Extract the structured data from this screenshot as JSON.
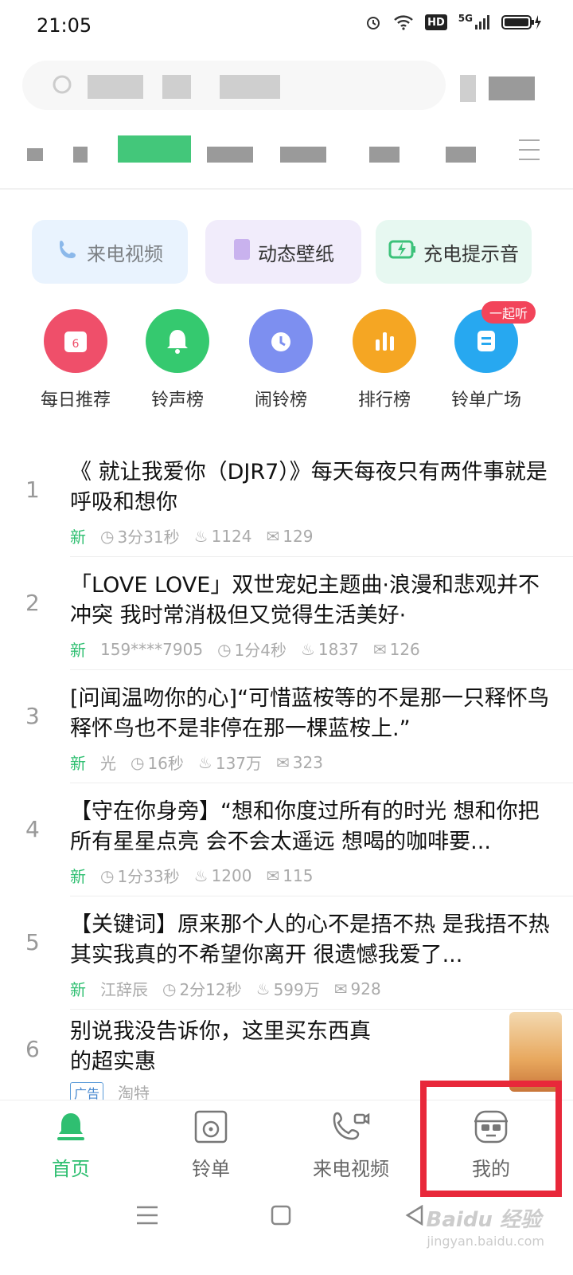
{
  "status_bar": {
    "time": "21:05",
    "hd": "HD",
    "net": "5G"
  },
  "quick_cards": [
    {
      "label": "来电视频"
    },
    {
      "label": "动态壁纸"
    },
    {
      "label": "充电提示音"
    }
  ],
  "categories": [
    {
      "label": "每日推荐",
      "color": "#ef4f6a"
    },
    {
      "label": "铃声榜",
      "color": "#35c96f"
    },
    {
      "label": "闹铃榜",
      "color": "#7d8ff0"
    },
    {
      "label": "排行榜",
      "color": "#f5a623"
    },
    {
      "label": "铃单广场",
      "color": "#27a8f0",
      "badge": "一起听"
    }
  ],
  "list": [
    {
      "num": "1",
      "title": "《 就让我爱你（DJR7）》每天每夜只有两件事就是呼吸和想你",
      "tag": "新",
      "author": "",
      "duration": "3分31秒",
      "likes": "1124",
      "comments": "129"
    },
    {
      "num": "2",
      "title": "「LOVE LOVE」双世宠妃主题曲·浪漫和悲观并不冲突 我时常消极但又觉得生活美好·",
      "tag": "新",
      "author": "159****7905",
      "duration": "1分4秒",
      "likes": "1837",
      "comments": "126"
    },
    {
      "num": "3",
      "title": "[问闻温吻你的心]“可惜蓝桉等的不是那一只释怀鸟 释怀鸟也不是非停在那一棵蓝桉上.”",
      "tag": "新",
      "author": "光",
      "duration": "16秒",
      "likes": "137万",
      "comments": "323"
    },
    {
      "num": "4",
      "title": "【守在你身旁】“想和你度过所有的时光 想和你把所有星星点亮 会不会太遥远 想喝的咖啡要...",
      "tag": "新",
      "author": "",
      "duration": "1分33秒",
      "likes": "1200",
      "comments": "115"
    },
    {
      "num": "5",
      "title": "【关键词】原来那个人的心不是捂不热 是我捂不热 其实我真的不希望你离开 很遗憾我爱了...",
      "tag": "新",
      "author": "江辞辰",
      "duration": "2分12秒",
      "likes": "599万",
      "comments": "928"
    }
  ],
  "ad": {
    "num": "6",
    "title": "别说我没告诉你，这里买东西真的超实惠",
    "tag": "广告",
    "source": "淘特"
  },
  "bottom_nav": [
    {
      "label": "首页",
      "active": true
    },
    {
      "label": "铃单",
      "active": false
    },
    {
      "label": "来电视频",
      "active": false
    },
    {
      "label": "我的",
      "active": false
    }
  ],
  "watermark": {
    "brand": "Baidu 经验",
    "url": "jingyan.baidu.com"
  },
  "colors": {
    "accent": "#2fbf71",
    "highlight": "#e8283a"
  }
}
